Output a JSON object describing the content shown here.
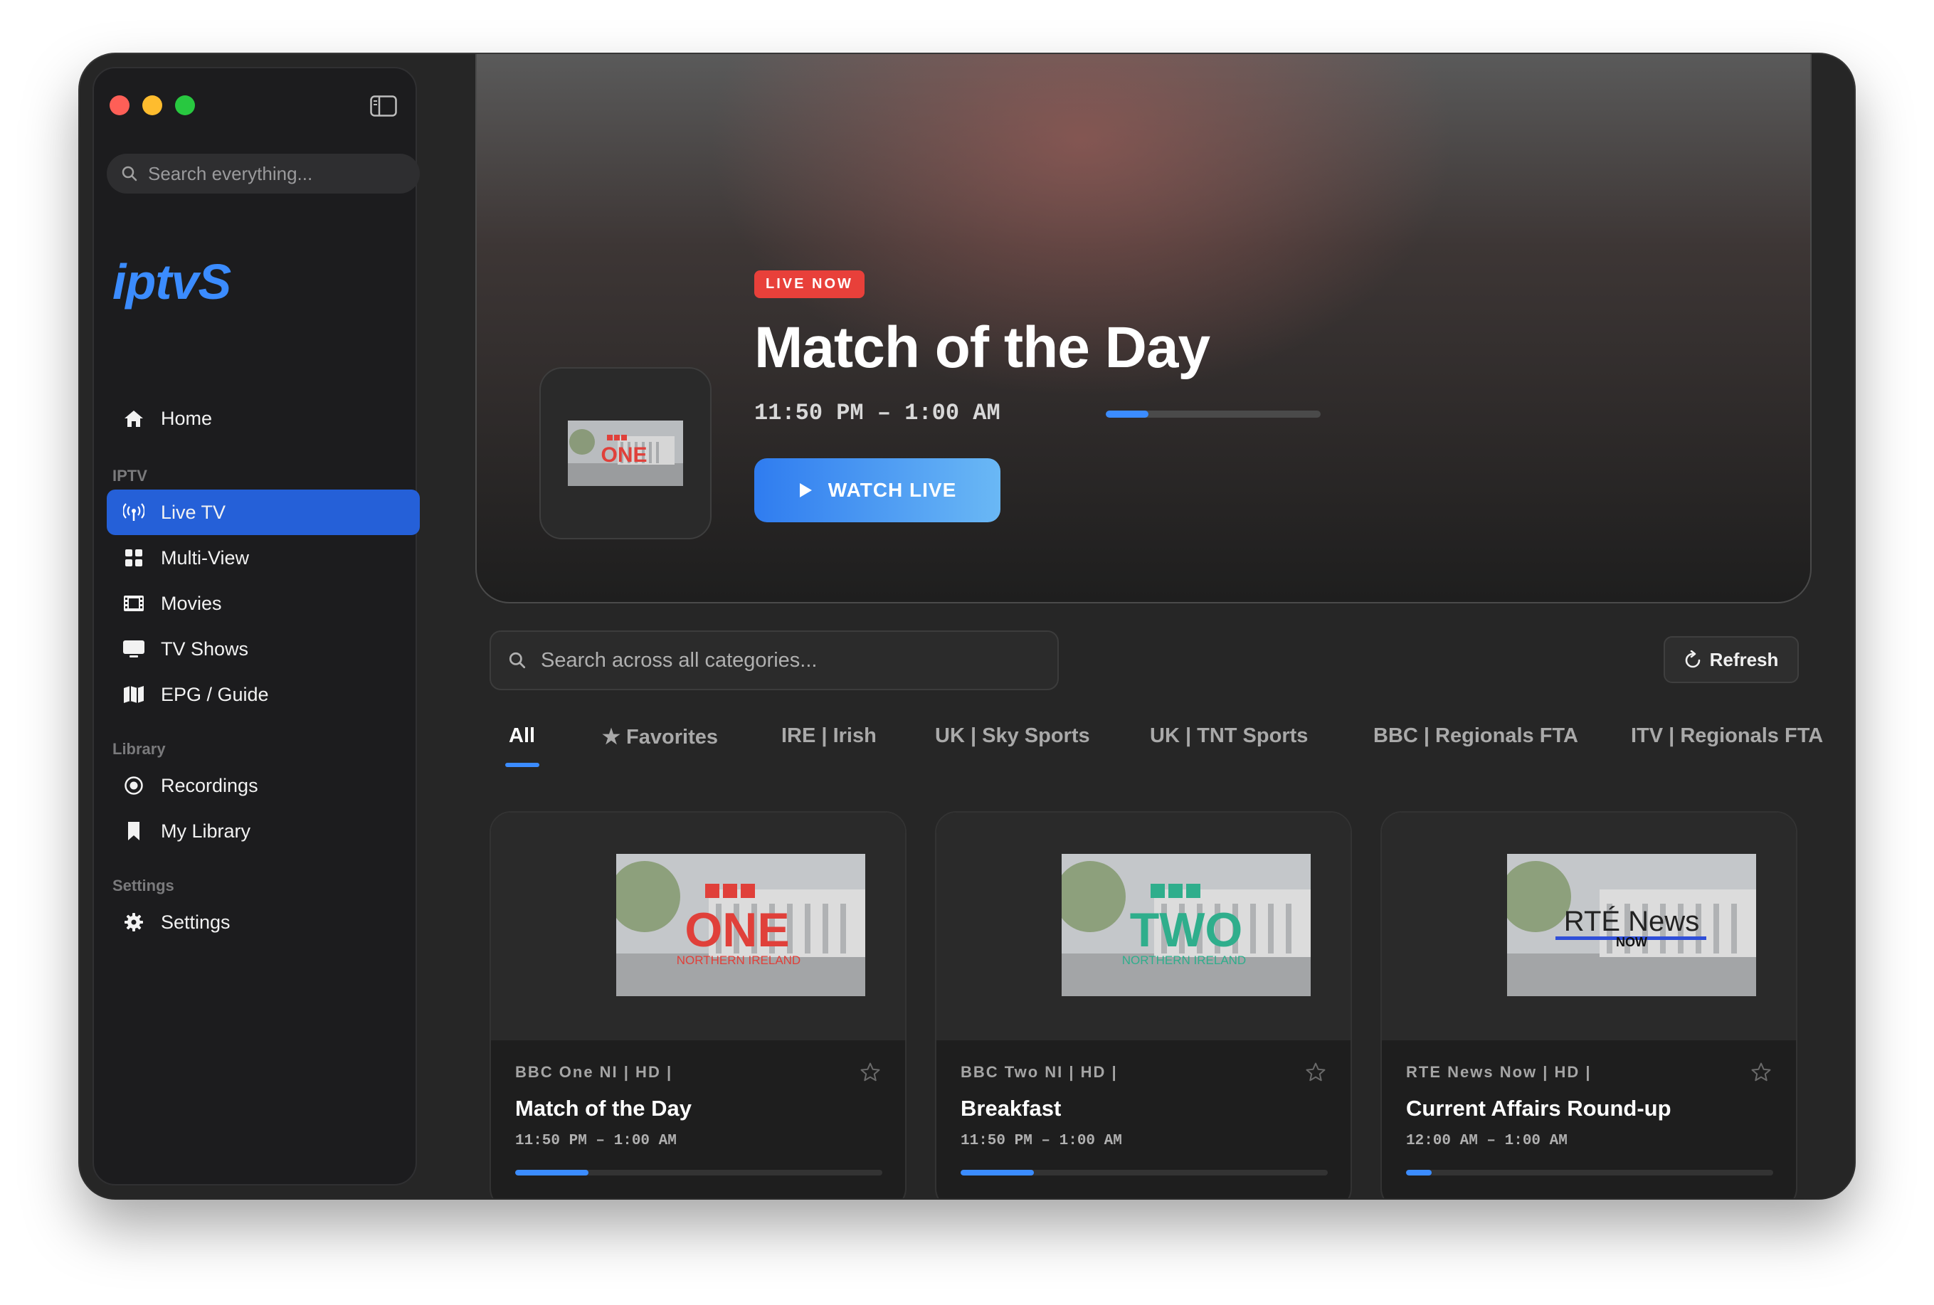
{
  "sidebar": {
    "search_placeholder": "Search everything...",
    "logo": "iptvS",
    "home_label": "Home",
    "section_iptv": "IPTV",
    "section_library": "Library",
    "section_settings": "Settings",
    "items": [
      {
        "label": "Live TV",
        "icon": "antenna-icon",
        "active": true
      },
      {
        "label": "Multi-View",
        "icon": "grid-icon"
      },
      {
        "label": "Movies",
        "icon": "film-icon"
      },
      {
        "label": "TV Shows",
        "icon": "tv-icon"
      },
      {
        "label": "EPG / Guide",
        "icon": "map-icon"
      },
      {
        "label": "Recordings",
        "icon": "record-icon"
      },
      {
        "label": "My Library",
        "icon": "bookmark-icon"
      },
      {
        "label": "Settings",
        "icon": "gear-icon"
      }
    ]
  },
  "hero": {
    "badge": "LIVE NOW",
    "title": "Match of the Day",
    "time": "11:50 PM – 1:00 AM",
    "progress": 0.2,
    "button_label": "WATCH LIVE",
    "thumb_text": "ONE"
  },
  "main": {
    "search_placeholder": "Search across all categories...",
    "refresh_label": "Refresh",
    "tabs": [
      "All",
      "★ Favorites",
      "IRE | Irish",
      "UK | Sky Sports",
      "UK | TNT Sports",
      "BBC | Regionals FTA",
      "ITV | Regionals FTA"
    ],
    "active_tab": "All"
  },
  "cards": [
    {
      "channel": "BBC One NI | HD |",
      "title": "Match of the Day",
      "time": "11:50 PM – 1:00 AM",
      "progress": 0.2,
      "logo_main": "ONE",
      "logo_sub": "NORTHERN IRELAND",
      "logo_color": "#e0403a"
    },
    {
      "channel": "BBC Two NI | HD |",
      "title": "Breakfast",
      "time": "11:50 PM – 1:00 AM",
      "progress": 0.2,
      "logo_main": "TWO",
      "logo_sub": "NORTHERN IRELAND",
      "logo_color": "#2fae8c"
    },
    {
      "channel": "RTE News Now | HD |",
      "title": "Current Affairs Round-up",
      "time": "12:00 AM – 1:00 AM",
      "progress": 0.07,
      "logo_main": "RTÉ News",
      "logo_sub": "NOW",
      "logo_color": "#222222"
    }
  ],
  "colors": {
    "accent": "#3b8cff",
    "live": "#e8403a",
    "active_nav": "#2560d8"
  }
}
